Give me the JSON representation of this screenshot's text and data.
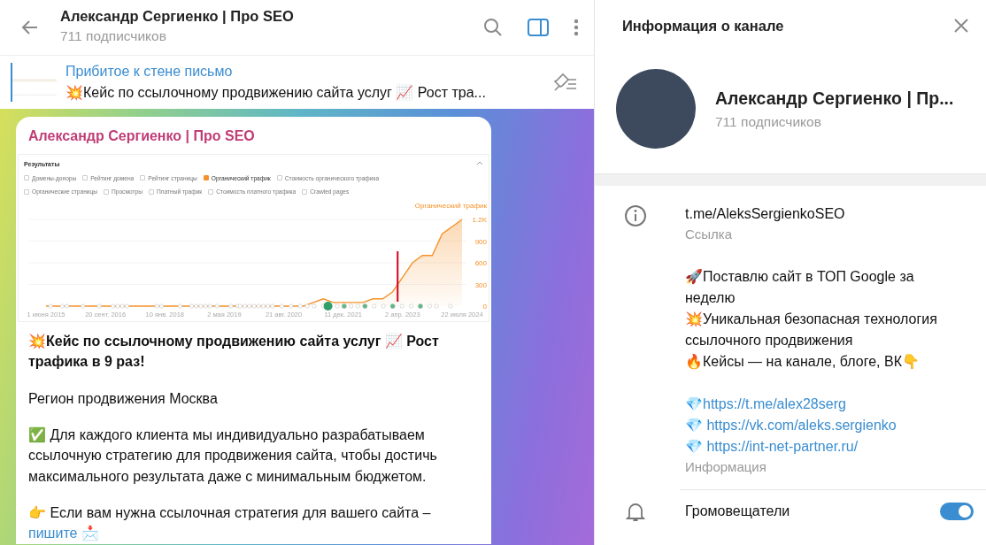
{
  "chat_header": {
    "title": "Александр Сергиенко | Про SEO",
    "subtitle": "711 подписчиков",
    "sidebar_open": true
  },
  "pinned": {
    "label": "Прибитое к стене письмо",
    "text": "💥Кейс по ссылочному продвижению сайта услуг 📈 Рост тра..."
  },
  "message": {
    "author": "Александр Сергиенко | Про SEO",
    "screenshot": {
      "title": "Результаты",
      "metrics": [
        {
          "label": "Домены-доноры",
          "checked": false
        },
        {
          "label": "Рейтинг домена",
          "checked": false
        },
        {
          "label": "Рейтинг страницы",
          "checked": false
        },
        {
          "label": "Органический трафик",
          "checked": true
        },
        {
          "label": "Стоимость органического трафика",
          "checked": false
        },
        {
          "label": "Органические страницы",
          "checked": false
        },
        {
          "label": "Просмотры",
          "checked": false
        },
        {
          "label": "Платный трафик",
          "checked": false
        },
        {
          "label": "Стоимость платного трафика",
          "checked": false
        },
        {
          "label": "Crawled pages",
          "checked": false
        }
      ],
      "chart_data": {
        "type": "area",
        "categories": [
          "1 июня 2015",
          null,
          null,
          null,
          null,
          null,
          "20 сент. 2016",
          null,
          null,
          null,
          null,
          null,
          "10 янв. 2018",
          null,
          null,
          null,
          null,
          null,
          "2 мая 2019",
          null,
          null,
          null,
          null,
          null,
          "21 авг. 2020",
          null,
          null,
          null,
          null,
          null,
          "11 дек. 2021",
          null,
          null,
          null,
          null,
          null,
          "2 апр. 2023",
          null,
          null,
          null,
          null,
          null,
          "22 июля 2024"
        ],
        "series": [
          {
            "name": "Органический трафик",
            "color": "#f5922a",
            "values": [
              0,
              0,
              0,
              0,
              0,
              0,
              0,
              0,
              0,
              0,
              0,
              0,
              0,
              0,
              0,
              0,
              0,
              0,
              0,
              0,
              0,
              0,
              0,
              0,
              0,
              0,
              0,
              50,
              100,
              50,
              50,
              50,
              50,
              100,
              100,
              200,
              400,
              600,
              700,
              700,
              1000,
              1100,
              1200
            ]
          }
        ],
        "ylim": [
          0,
          1200
        ],
        "grid": true,
        "yticks": [
          {
            "value": 0,
            "label": "0"
          },
          {
            "value": 300,
            "label": "300"
          },
          {
            "value": 600,
            "label": "600"
          },
          {
            "value": 900,
            "label": "900"
          },
          {
            "value": 1200,
            "label": "1.2K"
          }
        ],
        "stacked": false
      }
    },
    "paragraphs": [
      {
        "kind": "bold",
        "text": "💥Кейс по ссылочному продвижению сайта услуг 📈 Рост трафика в 9 раз!"
      },
      {
        "kind": "text",
        "text": "Регион продвижения Москва"
      },
      {
        "kind": "text",
        "text": "✅ Для каждого клиента мы индивидуально разрабатываем ссылочную стратегию для продвижения сайта, чтобы достичь максимального результата даже с минимальным бюджетом."
      },
      {
        "kind": "link_end",
        "text": "👉 Если вам нужна ссылочная стратегия для вашего сайта –",
        "link": "пишите",
        "suffix": "📩"
      }
    ]
  },
  "info_panel": {
    "title": "Информация о канале",
    "name": "Александр Сергиенко | Пр...",
    "subscribers": "711 подписчиков",
    "link": {
      "value": "t.me/AleksSergienkoSEO",
      "label": "Ссылка"
    },
    "about": {
      "blocks": [
        [
          {
            "kind": "text",
            "text": "🚀Поставлю сайт в ТОП Google за неделю"
          },
          {
            "kind": "text",
            "text": "💥Уникальная безопасная технология ссылочного продвижения"
          },
          {
            "kind": "text",
            "text": "🔥Кейсы — на канале, блоге, ВК👇"
          }
        ],
        [
          {
            "kind": "link",
            "prefix": "💎",
            "url": "https://t.me/alex28serg"
          },
          {
            "kind": "link",
            "prefix": "💎 ",
            "url": "https://vk.com/aleks.sergienko"
          },
          {
            "kind": "link",
            "prefix": "💎 ",
            "url": "https://int-net-partner.ru/"
          }
        ]
      ],
      "label": "Информация"
    },
    "notifications": {
      "label": "Громовещатели",
      "on": true
    }
  }
}
